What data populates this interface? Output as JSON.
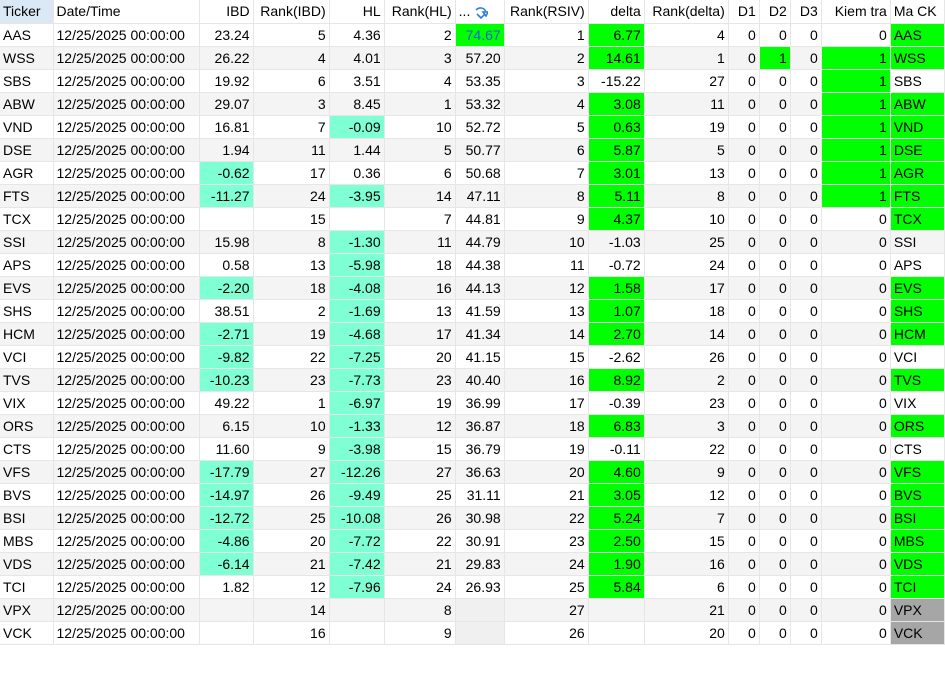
{
  "columns": {
    "ticker": "Ticker",
    "datetime": "Date/Time",
    "ibd": "IBD",
    "rank_ibd": "Rank(IBD)",
    "hl": "HL",
    "rank_hl": "Rank(HL)",
    "rsiv": "...",
    "rank_rsiv": "Rank(RSIV)",
    "delta": "delta",
    "rank_delta": "Rank(delta)",
    "d1": "D1",
    "d2": "D2",
    "d3": "D3",
    "kiem_tra": "Kiem tra",
    "ma_ck": "Ma CK"
  },
  "sort_icon": "sort-arrow-icon",
  "colors": {
    "aqua": "#7fffd4",
    "green": "#00ff00",
    "gray": "#a6a6a6",
    "blue_text": "#1f5fd1",
    "header_highlight": "#dbe8f6"
  },
  "rows": [
    {
      "ticker": "AAS",
      "datetime": "12/25/2025 00:00:00",
      "ibd": "23.24",
      "rank_ibd": "5",
      "hl": "4.36",
      "rank_hl": "2",
      "rsiv": "74.67",
      "rank_rsiv": "1",
      "delta": "6.77",
      "rank_delta": "4",
      "d1": "0",
      "d2": "0",
      "d3": "0",
      "kiem_tra": "0",
      "ma_ck": "AAS"
    },
    {
      "ticker": "WSS",
      "datetime": "12/25/2025 00:00:00",
      "ibd": "26.22",
      "rank_ibd": "4",
      "hl": "4.01",
      "rank_hl": "3",
      "rsiv": "57.20",
      "rank_rsiv": "2",
      "delta": "14.61",
      "rank_delta": "1",
      "d1": "0",
      "d2": "1",
      "d3": "0",
      "kiem_tra": "1",
      "ma_ck": "WSS"
    },
    {
      "ticker": "SBS",
      "datetime": "12/25/2025 00:00:00",
      "ibd": "19.92",
      "rank_ibd": "6",
      "hl": "3.51",
      "rank_hl": "4",
      "rsiv": "53.35",
      "rank_rsiv": "3",
      "delta": "-15.22",
      "rank_delta": "27",
      "d1": "0",
      "d2": "0",
      "d3": "0",
      "kiem_tra": "1",
      "ma_ck": "SBS"
    },
    {
      "ticker": "ABW",
      "datetime": "12/25/2025 00:00:00",
      "ibd": "29.07",
      "rank_ibd": "3",
      "hl": "8.45",
      "rank_hl": "1",
      "rsiv": "53.32",
      "rank_rsiv": "4",
      "delta": "3.08",
      "rank_delta": "11",
      "d1": "0",
      "d2": "0",
      "d3": "0",
      "kiem_tra": "1",
      "ma_ck": "ABW"
    },
    {
      "ticker": "VND",
      "datetime": "12/25/2025 00:00:00",
      "ibd": "16.81",
      "rank_ibd": "7",
      "hl": "-0.09",
      "rank_hl": "10",
      "rsiv": "52.72",
      "rank_rsiv": "5",
      "delta": "0.63",
      "rank_delta": "19",
      "d1": "0",
      "d2": "0",
      "d3": "0",
      "kiem_tra": "1",
      "ma_ck": "VND"
    },
    {
      "ticker": "DSE",
      "datetime": "12/25/2025 00:00:00",
      "ibd": "1.94",
      "rank_ibd": "11",
      "hl": "1.44",
      "rank_hl": "5",
      "rsiv": "50.77",
      "rank_rsiv": "6",
      "delta": "5.87",
      "rank_delta": "5",
      "d1": "0",
      "d2": "0",
      "d3": "0",
      "kiem_tra": "1",
      "ma_ck": "DSE"
    },
    {
      "ticker": "AGR",
      "datetime": "12/25/2025 00:00:00",
      "ibd": "-0.62",
      "rank_ibd": "17",
      "hl": "0.36",
      "rank_hl": "6",
      "rsiv": "50.68",
      "rank_rsiv": "7",
      "delta": "3.01",
      "rank_delta": "13",
      "d1": "0",
      "d2": "0",
      "d3": "0",
      "kiem_tra": "1",
      "ma_ck": "AGR"
    },
    {
      "ticker": "FTS",
      "datetime": "12/25/2025 00:00:00",
      "ibd": "-11.27",
      "rank_ibd": "24",
      "hl": "-3.95",
      "rank_hl": "14",
      "rsiv": "47.11",
      "rank_rsiv": "8",
      "delta": "5.11",
      "rank_delta": "8",
      "d1": "0",
      "d2": "0",
      "d3": "0",
      "kiem_tra": "1",
      "ma_ck": "FTS"
    },
    {
      "ticker": "TCX",
      "datetime": "12/25/2025 00:00:00",
      "ibd": "",
      "rank_ibd": "15",
      "hl": "",
      "rank_hl": "7",
      "rsiv": "44.81",
      "rank_rsiv": "9",
      "delta": "4.37",
      "rank_delta": "10",
      "d1": "0",
      "d2": "0",
      "d3": "0",
      "kiem_tra": "0",
      "ma_ck": "TCX"
    },
    {
      "ticker": "SSI",
      "datetime": "12/25/2025 00:00:00",
      "ibd": "15.98",
      "rank_ibd": "8",
      "hl": "-1.30",
      "rank_hl": "11",
      "rsiv": "44.79",
      "rank_rsiv": "10",
      "delta": "-1.03",
      "rank_delta": "25",
      "d1": "0",
      "d2": "0",
      "d3": "0",
      "kiem_tra": "0",
      "ma_ck": "SSI"
    },
    {
      "ticker": "APS",
      "datetime": "12/25/2025 00:00:00",
      "ibd": "0.58",
      "rank_ibd": "13",
      "hl": "-5.98",
      "rank_hl": "18",
      "rsiv": "44.38",
      "rank_rsiv": "11",
      "delta": "-0.72",
      "rank_delta": "24",
      "d1": "0",
      "d2": "0",
      "d3": "0",
      "kiem_tra": "0",
      "ma_ck": "APS"
    },
    {
      "ticker": "EVS",
      "datetime": "12/25/2025 00:00:00",
      "ibd": "-2.20",
      "rank_ibd": "18",
      "hl": "-4.08",
      "rank_hl": "16",
      "rsiv": "44.13",
      "rank_rsiv": "12",
      "delta": "1.58",
      "rank_delta": "17",
      "d1": "0",
      "d2": "0",
      "d3": "0",
      "kiem_tra": "0",
      "ma_ck": "EVS"
    },
    {
      "ticker": "SHS",
      "datetime": "12/25/2025 00:00:00",
      "ibd": "38.51",
      "rank_ibd": "2",
      "hl": "-1.69",
      "rank_hl": "13",
      "rsiv": "41.59",
      "rank_rsiv": "13",
      "delta": "1.07",
      "rank_delta": "18",
      "d1": "0",
      "d2": "0",
      "d3": "0",
      "kiem_tra": "0",
      "ma_ck": "SHS"
    },
    {
      "ticker": "HCM",
      "datetime": "12/25/2025 00:00:00",
      "ibd": "-2.71",
      "rank_ibd": "19",
      "hl": "-4.68",
      "rank_hl": "17",
      "rsiv": "41.34",
      "rank_rsiv": "14",
      "delta": "2.70",
      "rank_delta": "14",
      "d1": "0",
      "d2": "0",
      "d3": "0",
      "kiem_tra": "0",
      "ma_ck": "HCM"
    },
    {
      "ticker": "VCI",
      "datetime": "12/25/2025 00:00:00",
      "ibd": "-9.82",
      "rank_ibd": "22",
      "hl": "-7.25",
      "rank_hl": "20",
      "rsiv": "41.15",
      "rank_rsiv": "15",
      "delta": "-2.62",
      "rank_delta": "26",
      "d1": "0",
      "d2": "0",
      "d3": "0",
      "kiem_tra": "0",
      "ma_ck": "VCI"
    },
    {
      "ticker": "TVS",
      "datetime": "12/25/2025 00:00:00",
      "ibd": "-10.23",
      "rank_ibd": "23",
      "hl": "-7.73",
      "rank_hl": "23",
      "rsiv": "40.40",
      "rank_rsiv": "16",
      "delta": "8.92",
      "rank_delta": "2",
      "d1": "0",
      "d2": "0",
      "d3": "0",
      "kiem_tra": "0",
      "ma_ck": "TVS"
    },
    {
      "ticker": "VIX",
      "datetime": "12/25/2025 00:00:00",
      "ibd": "49.22",
      "rank_ibd": "1",
      "hl": "-6.97",
      "rank_hl": "19",
      "rsiv": "36.99",
      "rank_rsiv": "17",
      "delta": "-0.39",
      "rank_delta": "23",
      "d1": "0",
      "d2": "0",
      "d3": "0",
      "kiem_tra": "0",
      "ma_ck": "VIX"
    },
    {
      "ticker": "ORS",
      "datetime": "12/25/2025 00:00:00",
      "ibd": "6.15",
      "rank_ibd": "10",
      "hl": "-1.33",
      "rank_hl": "12",
      "rsiv": "36.87",
      "rank_rsiv": "18",
      "delta": "6.83",
      "rank_delta": "3",
      "d1": "0",
      "d2": "0",
      "d3": "0",
      "kiem_tra": "0",
      "ma_ck": "ORS"
    },
    {
      "ticker": "CTS",
      "datetime": "12/25/2025 00:00:00",
      "ibd": "11.60",
      "rank_ibd": "9",
      "hl": "-3.98",
      "rank_hl": "15",
      "rsiv": "36.79",
      "rank_rsiv": "19",
      "delta": "-0.11",
      "rank_delta": "22",
      "d1": "0",
      "d2": "0",
      "d3": "0",
      "kiem_tra": "0",
      "ma_ck": "CTS"
    },
    {
      "ticker": "VFS",
      "datetime": "12/25/2025 00:00:00",
      "ibd": "-17.79",
      "rank_ibd": "27",
      "hl": "-12.26",
      "rank_hl": "27",
      "rsiv": "36.63",
      "rank_rsiv": "20",
      "delta": "4.60",
      "rank_delta": "9",
      "d1": "0",
      "d2": "0",
      "d3": "0",
      "kiem_tra": "0",
      "ma_ck": "VFS"
    },
    {
      "ticker": "BVS",
      "datetime": "12/25/2025 00:00:00",
      "ibd": "-14.97",
      "rank_ibd": "26",
      "hl": "-9.49",
      "rank_hl": "25",
      "rsiv": "31.11",
      "rank_rsiv": "21",
      "delta": "3.05",
      "rank_delta": "12",
      "d1": "0",
      "d2": "0",
      "d3": "0",
      "kiem_tra": "0",
      "ma_ck": "BVS"
    },
    {
      "ticker": "BSI",
      "datetime": "12/25/2025 00:00:00",
      "ibd": "-12.72",
      "rank_ibd": "25",
      "hl": "-10.08",
      "rank_hl": "26",
      "rsiv": "30.98",
      "rank_rsiv": "22",
      "delta": "5.24",
      "rank_delta": "7",
      "d1": "0",
      "d2": "0",
      "d3": "0",
      "kiem_tra": "0",
      "ma_ck": "BSI"
    },
    {
      "ticker": "MBS",
      "datetime": "12/25/2025 00:00:00",
      "ibd": "-4.86",
      "rank_ibd": "20",
      "hl": "-7.72",
      "rank_hl": "22",
      "rsiv": "30.91",
      "rank_rsiv": "23",
      "delta": "2.50",
      "rank_delta": "15",
      "d1": "0",
      "d2": "0",
      "d3": "0",
      "kiem_tra": "0",
      "ma_ck": "MBS"
    },
    {
      "ticker": "VDS",
      "datetime": "12/25/2025 00:00:00",
      "ibd": "-6.14",
      "rank_ibd": "21",
      "hl": "-7.42",
      "rank_hl": "21",
      "rsiv": "29.83",
      "rank_rsiv": "24",
      "delta": "1.90",
      "rank_delta": "16",
      "d1": "0",
      "d2": "0",
      "d3": "0",
      "kiem_tra": "0",
      "ma_ck": "VDS"
    },
    {
      "ticker": "TCI",
      "datetime": "12/25/2025 00:00:00",
      "ibd": "1.82",
      "rank_ibd": "12",
      "hl": "-7.96",
      "rank_hl": "24",
      "rsiv": "26.93",
      "rank_rsiv": "25",
      "delta": "5.84",
      "rank_delta": "6",
      "d1": "0",
      "d2": "0",
      "d3": "0",
      "kiem_tra": "0",
      "ma_ck": "TCI"
    },
    {
      "ticker": "VPX",
      "datetime": "12/25/2025 00:00:00",
      "ibd": "",
      "rank_ibd": "14",
      "hl": "",
      "rank_hl": "8",
      "rsiv": "",
      "rank_rsiv": "27",
      "delta": "",
      "rank_delta": "21",
      "d1": "0",
      "d2": "0",
      "d3": "0",
      "kiem_tra": "0",
      "ma_ck": "VPX"
    },
    {
      "ticker": "VCK",
      "datetime": "12/25/2025 00:00:00",
      "ibd": "",
      "rank_ibd": "16",
      "hl": "",
      "rank_hl": "9",
      "rsiv": "",
      "rank_rsiv": "26",
      "delta": "",
      "rank_delta": "20",
      "d1": "0",
      "d2": "0",
      "d3": "0",
      "kiem_tra": "0",
      "ma_ck": "VCK"
    }
  ]
}
